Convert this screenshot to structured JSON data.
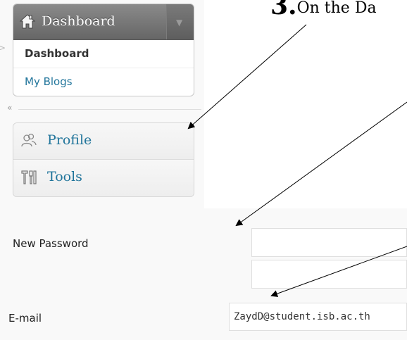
{
  "heading": {
    "number": "3.",
    "text": "On the Da"
  },
  "dashboard_menu": {
    "title": "Dashboard",
    "items": [
      {
        "label": "Dashboard",
        "current": true
      },
      {
        "label": "My Blogs",
        "current": false
      }
    ]
  },
  "collapse_glyph": "«",
  "sidebar": {
    "items": [
      {
        "label": "Profile",
        "icon": "users-icon"
      },
      {
        "label": "Tools",
        "icon": "tools-icon"
      }
    ]
  },
  "form": {
    "new_password": {
      "label": "New Password",
      "value": "",
      "repeat_value": ""
    },
    "email": {
      "label": "E-mail",
      "value": "ZaydD@student.isb.ac.th"
    }
  },
  "colors": {
    "link": "#21759b",
    "header": "#707070",
    "background": "#f9f9f9"
  }
}
